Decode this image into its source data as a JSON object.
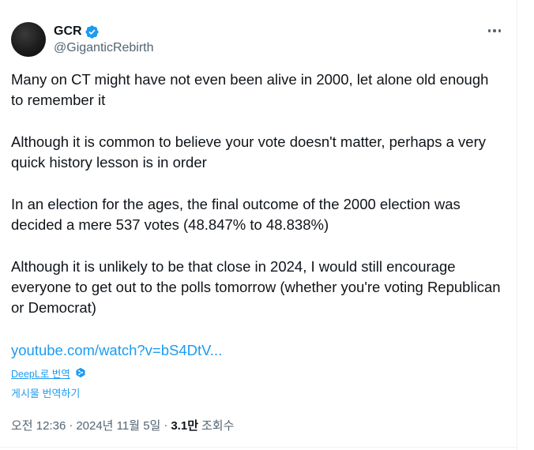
{
  "author": {
    "display_name": "GCR",
    "handle": "@GiganticRebirth",
    "verified_icon": "verified-badge-icon",
    "badge_color": "#1d9bf0"
  },
  "tweet": {
    "paragraphs": [
      "Many on CT might have not even been alive in 2000, let alone old enough to remember it",
      "Although it is common to believe your vote doesn't matter, perhaps a very quick history lesson is in order",
      "In an election for the ages, the final outcome of the 2000 election was decided a mere 537 votes (48.847% to 48.838%)",
      "Although it is unlikely to be that close in 2024, I would still encourage everyone to get out to the polls tomorrow (whether you're voting Republican or Democrat)"
    ],
    "link_text": "youtube.com/watch?v=bS4DtV..."
  },
  "translation": {
    "deepl_label": "DeepL로 번역",
    "deepl_icon": "deepl-icon",
    "translate_post_label": "게시물 번역하기"
  },
  "meta": {
    "time": "오전 12:36",
    "date": "2024년 11월 5일",
    "views_count": "3.1만",
    "views_label": "조회수",
    "separator": "·"
  },
  "menu": {
    "more_icon": "more-icon"
  },
  "colors": {
    "text": "#0f1419",
    "secondary": "#536471",
    "link": "#1d9bf0"
  }
}
